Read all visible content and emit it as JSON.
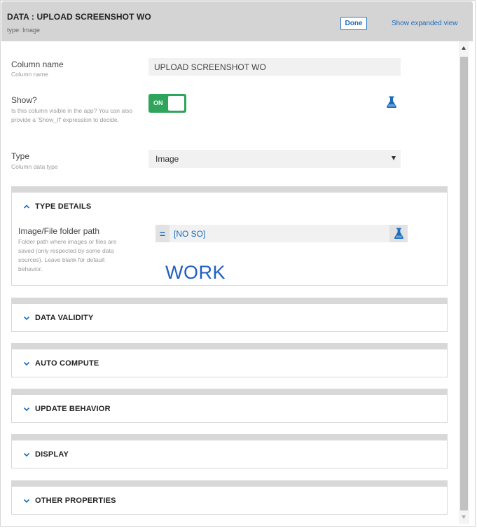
{
  "header": {
    "title": "DATA : UPLOAD SCREENSHOT WO",
    "subtitle": "type: Image",
    "done_label": "Done",
    "expand_label": "Show expanded view"
  },
  "fields": {
    "column_name": {
      "label": "Column name",
      "help": "Column name",
      "value": "UPLOAD SCREENSHOT WO"
    },
    "show": {
      "label": "Show?",
      "help": "Is this column visible in the app? You can also provide a 'Show_If' expression to decide.",
      "toggle_label": "ON",
      "toggle_on": true
    },
    "type": {
      "label": "Type",
      "help": "Column data type",
      "value": "Image"
    }
  },
  "sections": {
    "type_details": {
      "title": "TYPE DETAILS",
      "expanded": true,
      "folder_path": {
        "label": "Image/File folder path",
        "help": "Folder path where images or files are saved (only respected by some data sources). Leave blank for default behavior.",
        "eq_symbol": "=",
        "value": "[NO SO]"
      },
      "annotation": "WORK"
    },
    "data_validity": {
      "title": "DATA VALIDITY"
    },
    "auto_compute": {
      "title": "AUTO COMPUTE"
    },
    "update_behavior": {
      "title": "UPDATE BEHAVIOR"
    },
    "display": {
      "title": "DISPLAY"
    },
    "other_properties": {
      "title": "OTHER PROPERTIES"
    }
  },
  "colors": {
    "accent": "#1a6cbd",
    "toggle_on": "#2ea55a",
    "header_bg": "#d4d4d4",
    "annotation": "#2060c0"
  },
  "icons": {
    "flask": "flask-icon",
    "chevron_up": "chevron-up-icon",
    "chevron_down": "chevron-down-icon"
  }
}
